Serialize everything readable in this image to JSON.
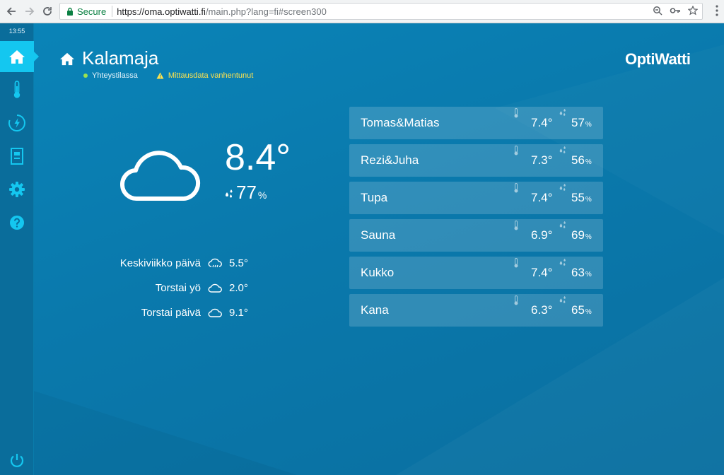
{
  "browser": {
    "secure_label": "Secure",
    "url_host": "https://oma.optiwatti.fi",
    "url_rest": "/main.php?lang=fi#screen300"
  },
  "sidebar": {
    "clock": "13:55",
    "items": [
      {
        "icon": "home-icon",
        "active": true
      },
      {
        "icon": "thermometer-icon",
        "active": false
      },
      {
        "icon": "energy-icon",
        "active": false
      },
      {
        "icon": "fusebox-icon",
        "active": false
      },
      {
        "icon": "gear-icon",
        "active": false
      },
      {
        "icon": "help-icon",
        "active": false
      }
    ]
  },
  "header": {
    "title": "Kalamaja",
    "status_online": "Yhteystilassa",
    "status_warning": "Mittausdata vanhentunut",
    "logo": "OptiWatti"
  },
  "weather": {
    "temperature": "8.4°",
    "humidity": "77",
    "humidity_unit": "%",
    "forecast": [
      {
        "label": "Keskiviikko päivä",
        "icon": "cloud-rain-icon",
        "value": "5.5°"
      },
      {
        "label": "Torstai yö",
        "icon": "cloud-icon",
        "value": "2.0°"
      },
      {
        "label": "Torstai päivä",
        "icon": "cloud-icon",
        "value": "9.1°"
      }
    ]
  },
  "rooms": [
    {
      "name": "Tomas&Matias",
      "temp": "7.4°",
      "hum": "57",
      "unit": "%"
    },
    {
      "name": "Rezi&Juha",
      "temp": "7.3°",
      "hum": "56",
      "unit": "%"
    },
    {
      "name": "Tupa",
      "temp": "7.4°",
      "hum": "55",
      "unit": "%"
    },
    {
      "name": "Sauna",
      "temp": "6.9°",
      "hum": "69",
      "unit": "%"
    },
    {
      "name": "Kukko",
      "temp": "7.4°",
      "hum": "63",
      "unit": "%"
    },
    {
      "name": "Kana",
      "temp": "6.3°",
      "hum": "65",
      "unit": "%"
    }
  ],
  "colors": {
    "background": "#0a79ac",
    "accent": "#14c7f0",
    "warning": "#ffe34d",
    "online": "#9be24f"
  }
}
